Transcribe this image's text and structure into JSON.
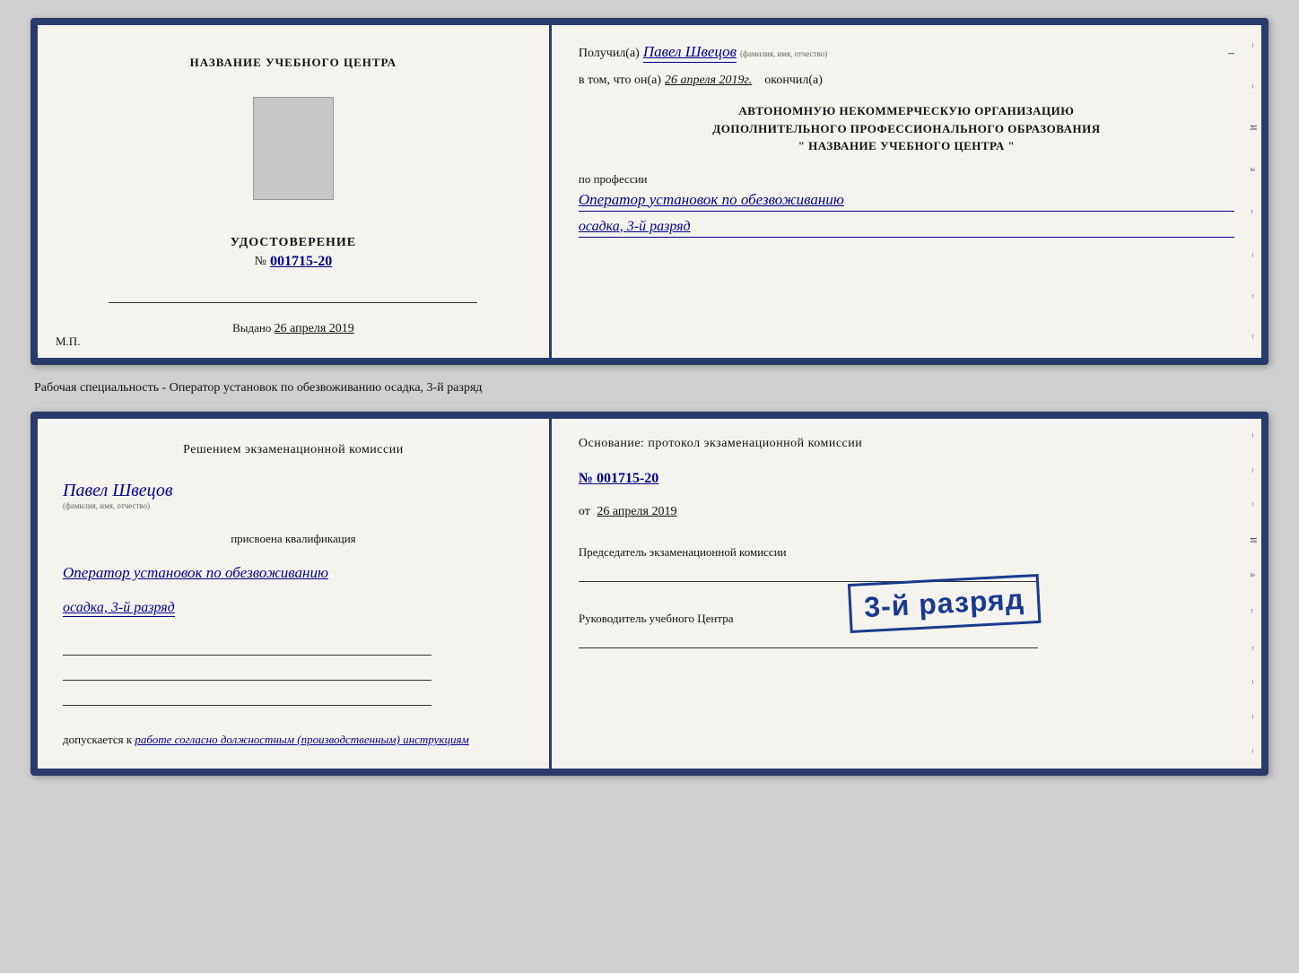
{
  "top_card": {
    "left": {
      "center_title": "НАЗВАНИЕ УЧЕБНОГО ЦЕНТРА",
      "cert_label": "УДОСТОВЕРЕНИЕ",
      "cert_number_prefix": "№",
      "cert_number": "001715-20",
      "issued_label": "Выдано",
      "issued_date": "26 апреля 2019",
      "mp_label": "М.П."
    },
    "right": {
      "received_label": "Получил(а)",
      "received_name": "Павел Швецов",
      "name_sublabel": "(фамилия, имя, отчество)",
      "dash": "–",
      "in_that_label": "в том, что он(а)",
      "completed_date": "26 апреля 2019г.",
      "completed_label": "окончил(а)",
      "org_line1": "АВТОНОМНУЮ НЕКОММЕРЧЕСКУЮ ОРГАНИЗАЦИЮ",
      "org_line2": "ДОПОЛНИТЕЛЬНОГО ПРОФЕССИОНАЛЬНОГО ОБРАЗОВАНИЯ",
      "org_line3": "\" НАЗВАНИЕ УЧЕБНОГО ЦЕНТРА \"",
      "profession_label": "по профессии",
      "profession_value": "Оператор установок по обезвоживанию",
      "rank_value": "осадка, 3-й разряд"
    }
  },
  "caption": "Рабочая специальность - Оператор установок по обезвоживанию осадка, 3-й разряд",
  "bottom_card": {
    "left": {
      "decision_title": "Решением экзаменационной комиссии",
      "person_name": "Павел Швецов",
      "person_sublabel": "(фамилия, имя, отчество)",
      "assigned_label": "присвоена квалификация",
      "qualification_value": "Оператор установок по обезвоживанию",
      "rank_value": "осадка, 3-й разряд",
      "allowed_label": "допускается к",
      "allowed_value": "работе согласно должностным (производственным) инструкциям"
    },
    "right": {
      "basis_title": "Основание: протокол экзаменационной комиссии",
      "protocol_prefix": "№",
      "protocol_number": "001715-20",
      "from_prefix": "от",
      "from_date": "26 апреля 2019",
      "chairman_label": "Председатель экзаменационной комиссии",
      "director_label": "Руководитель учебного Центра"
    },
    "stamp": {
      "text": "3-й разряд"
    }
  },
  "right_edge": {
    "marks": [
      "И",
      "а",
      "←",
      "–",
      "–",
      "–",
      "–",
      "–"
    ]
  }
}
